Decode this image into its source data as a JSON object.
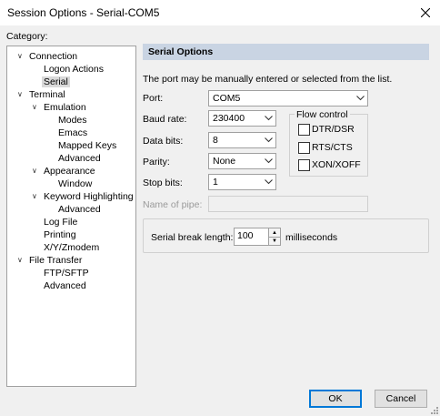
{
  "window": {
    "title": "Session Options - Serial-COM5"
  },
  "category_label": "Category:",
  "tree": [
    {
      "label": "Connection",
      "toggle": "∨"
    },
    {
      "label": "Logon Actions"
    },
    {
      "label": "Serial",
      "selected": true
    },
    {
      "label": "Terminal",
      "toggle": "∨"
    },
    {
      "label": "Emulation",
      "toggle": "∨"
    },
    {
      "label": "Modes"
    },
    {
      "label": "Emacs"
    },
    {
      "label": "Mapped Keys"
    },
    {
      "label": "Advanced"
    },
    {
      "label": "Appearance",
      "toggle": "∨"
    },
    {
      "label": "Window"
    },
    {
      "label": "Keyword Highlighting",
      "toggle": "∨"
    },
    {
      "label": "Advanced"
    },
    {
      "label": "Log File"
    },
    {
      "label": "Printing"
    },
    {
      "label": "X/Y/Zmodem"
    },
    {
      "label": "File Transfer",
      "toggle": "∨"
    },
    {
      "label": "FTP/SFTP"
    },
    {
      "label": "Advanced"
    }
  ],
  "serial": {
    "header": "Serial Options",
    "description": "The port may be manually entered or selected from the list.",
    "port": {
      "label": "Port:",
      "value": "COM5"
    },
    "baud": {
      "label": "Baud rate:",
      "value": "230400"
    },
    "databits": {
      "label": "Data bits:",
      "value": "8"
    },
    "parity": {
      "label": "Parity:",
      "value": "None"
    },
    "stopbits": {
      "label": "Stop bits:",
      "value": "1"
    },
    "pipe": {
      "label": "Name of pipe:",
      "value": ""
    },
    "flow": {
      "title": "Flow control",
      "dtr": {
        "label": "DTR/DSR",
        "checked": false
      },
      "rts": {
        "label": "RTS/CTS",
        "checked": false
      },
      "xon": {
        "label": "XON/XOFF",
        "checked": false
      }
    },
    "break": {
      "label": "Serial break length:",
      "value": "100",
      "unit": "milliseconds"
    }
  },
  "buttons": {
    "ok": "OK",
    "cancel": "Cancel"
  }
}
